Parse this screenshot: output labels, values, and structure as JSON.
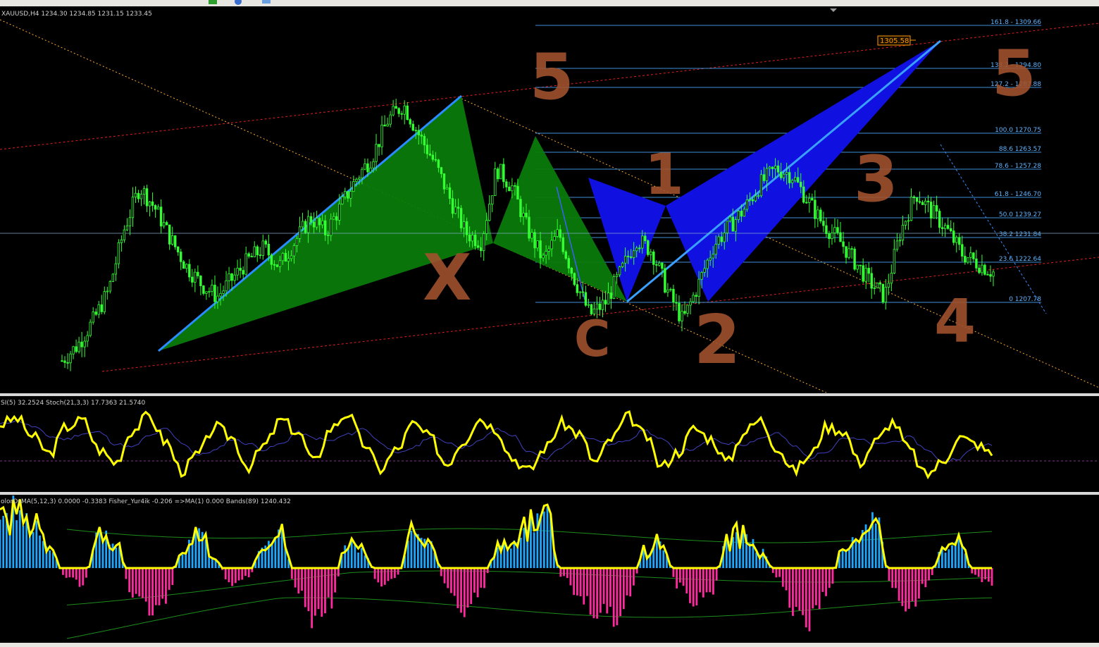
{
  "toolbar": {
    "bg": "#e8e6e0"
  },
  "header": {
    "symbol_info": "XAUUSD,H4  1234.30 1234.85 1231.15 1233.45"
  },
  "price_tag": "1305.58",
  "fib_levels": [
    {
      "label": "161.8 - 1309.66"
    },
    {
      "label": "138.2 - 1294.80"
    },
    {
      "label": "127.2 - 1287.88"
    },
    {
      "label": "100.0 1270.75"
    },
    {
      "label": "88.6 1263.57"
    },
    {
      "label": "78.6 - 1257.28"
    },
    {
      "label": "61.8 - 1246.70"
    },
    {
      "label": "50.0 1239.27"
    },
    {
      "label": "38.2 1231.84"
    },
    {
      "label": "23.6 1222.64"
    },
    {
      "label": "0 1207.78"
    }
  ],
  "handwritten_labels": [
    "5",
    "5",
    "1",
    "3",
    "X",
    "C",
    "2",
    "4"
  ],
  "panel2": {
    "label": "SI(5) 32.2524  Stoch(21,3,3) 17.7363 21.5740"
  },
  "panel3": {
    "label": "olorOsMA(5,12,3) 0.0000 -0.3383  Fisher_Yur4ik -0.206   =>MA(1) 0.000  Bands(89) 1240.432"
  },
  "colors": {
    "background": "#000000",
    "candles": "#33ff33",
    "fib": "#5fb3ff",
    "harmonic_green": "#0a8a0a",
    "harmonic_blue": "#1010e0",
    "stoch": "#ffff00",
    "osma_pos": "#1ea7ff",
    "osma_neg": "#ff2aa0",
    "marker": "#a0522d",
    "price_tag": "#ff9900"
  },
  "chart_data": [
    {
      "type": "candlestick",
      "title": "XAUUSD,H4",
      "ylim": [
        1195,
        1320
      ],
      "price_path": [
        1205,
        1210,
        1218,
        1228,
        1248,
        1262,
        1255,
        1245,
        1236,
        1230,
        1226,
        1232,
        1238,
        1242,
        1236,
        1244,
        1252,
        1247,
        1256,
        1265,
        1272,
        1284,
        1289,
        1279,
        1270,
        1258,
        1247,
        1244,
        1268,
        1262,
        1248,
        1238,
        1247,
        1232,
        1220,
        1224,
        1234,
        1245,
        1241,
        1228,
        1218,
        1230,
        1243,
        1249,
        1255,
        1263,
        1268,
        1266,
        1258,
        1250,
        1245,
        1238,
        1231,
        1226,
        1247,
        1260,
        1254,
        1248,
        1240,
        1237,
        1234
      ],
      "last_values": {
        "open": 1234.3,
        "high": 1234.85,
        "low": 1231.15,
        "close": 1233.45
      }
    },
    {
      "type": "line",
      "title": "SI(5) 32.2524  Stoch(21,3,3) 17.7363 21.5740",
      "ylim": [
        0,
        100
      ],
      "series": [
        {
          "name": "Stoch(21,3,3)",
          "values": [
            75,
            82,
            60,
            40,
            72,
            80,
            45,
            30,
            68,
            85,
            55,
            20,
            40,
            72,
            60,
            25,
            50,
            80,
            66,
            30,
            70,
            88,
            52,
            22,
            45,
            75,
            60,
            28,
            55,
            82,
            70,
            35,
            20,
            48,
            76,
            64,
            30,
            58,
            84,
            62,
            25,
            42,
            70,
            58,
            30,
            66,
            80,
            48,
            20,
            38,
            72,
            68,
            30,
            55,
            78,
            45,
            15,
            30,
            60,
            52,
            40
          ]
        }
      ]
    },
    {
      "type": "bar",
      "title": "olorOsMA(5,12,3) 0.0000 -0.3383  Fisher_Yur4ik -0.206   =>MA(1) 0.000  Bands(89) 1240.432",
      "ylim": [
        -10,
        10
      ],
      "series": [
        {
          "name": "olorOsMA(5,12,3)",
          "values": [
            6,
            7,
            5,
            2,
            -1,
            -2,
            4,
            3,
            -3,
            -5,
            -4,
            2,
            5,
            1,
            -2,
            -1,
            3,
            4,
            -3,
            -6,
            -4,
            3,
            2,
            -2,
            -1,
            4,
            3,
            -2,
            -5,
            -3,
            2,
            3,
            5,
            7,
            -1,
            -3,
            -5,
            -6,
            -4,
            2,
            3,
            -2,
            -4,
            -3,
            3,
            4,
            2,
            -1,
            -5,
            -6,
            -3,
            2,
            4,
            6,
            -3,
            -5,
            -2,
            2,
            3,
            -1,
            -2
          ]
        }
      ]
    }
  ]
}
